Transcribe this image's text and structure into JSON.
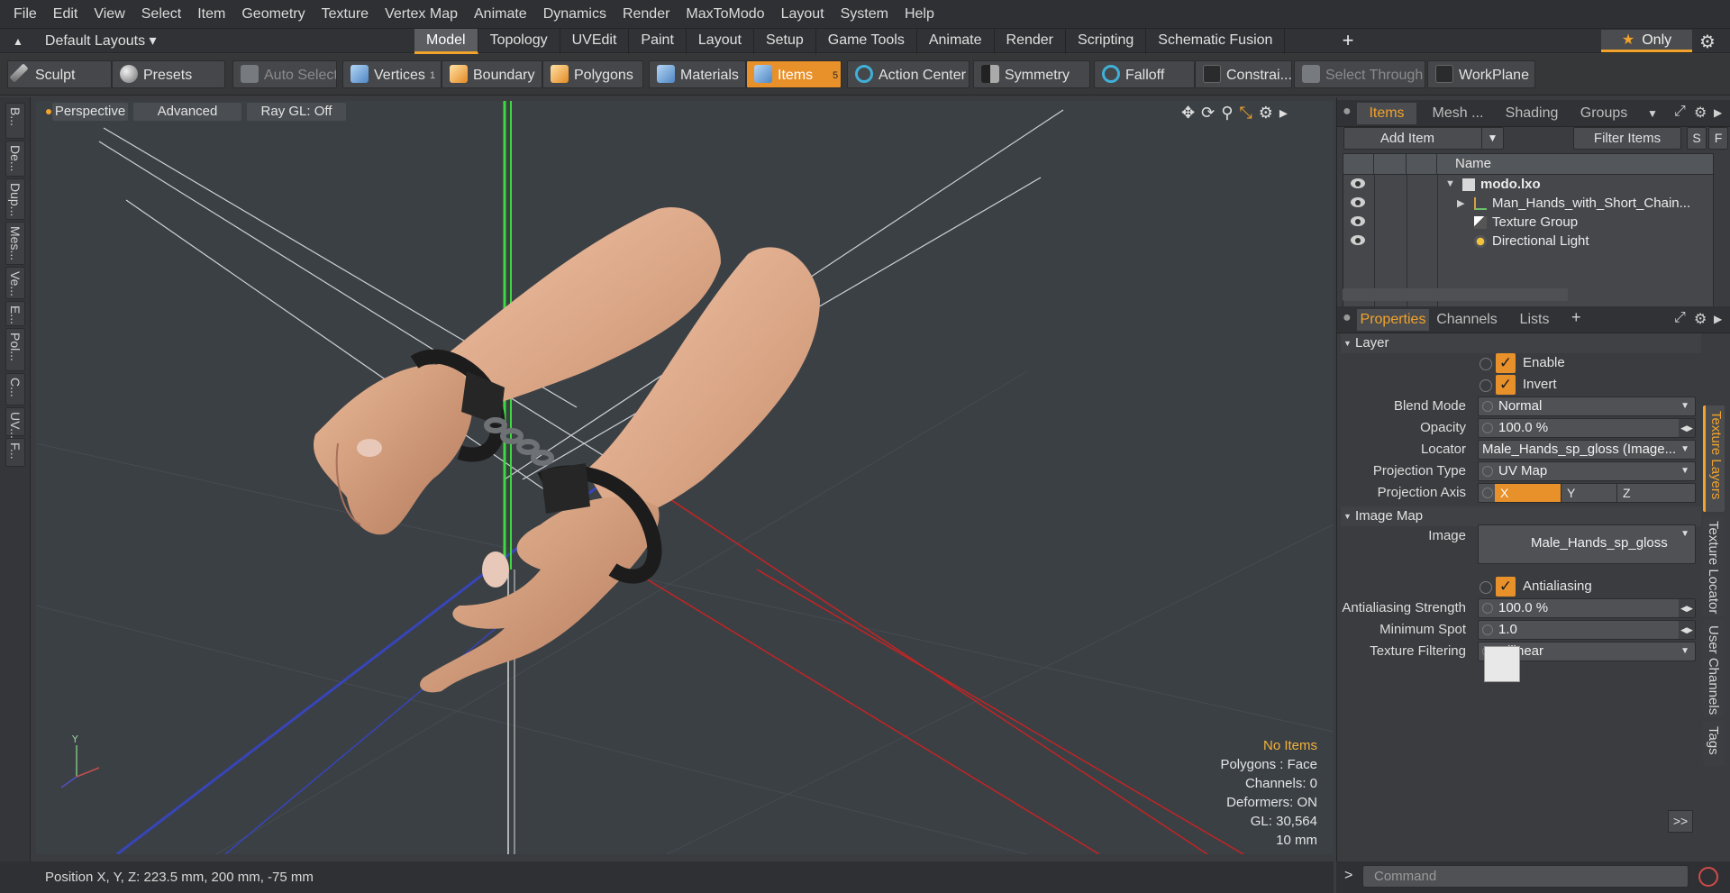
{
  "menu": [
    "File",
    "Edit",
    "View",
    "Select",
    "Item",
    "Geometry",
    "Texture",
    "Vertex Map",
    "Animate",
    "Dynamics",
    "Render",
    "MaxToModo",
    "Layout",
    "System",
    "Help"
  ],
  "layout_selector": "Default Layouts ▾",
  "layout_tabs": [
    "Model",
    "Topology",
    "UVEdit",
    "Paint",
    "Layout",
    "Setup",
    "Game Tools",
    "Animate",
    "Render",
    "Scripting",
    "Schematic Fusion"
  ],
  "only_label": "Only",
  "toolbar": {
    "sculpt": "Sculpt",
    "presets": "Presets",
    "auto_select": "Auto Select",
    "vertices": "Vertices",
    "vertices_count": "1",
    "boundary": "Boundary",
    "polygons": "Polygons",
    "materials": "Materials",
    "items": "Items",
    "items_count": "5",
    "action_center": "Action Center",
    "symmetry": "Symmetry",
    "falloff": "Falloff",
    "constraints": "Constrai...",
    "select_through": "Select Through",
    "workplane": "WorkPlane"
  },
  "left_strip": [
    "B...",
    "De...",
    "Dup...",
    "Mes...",
    "Ve...",
    "E...",
    "Pol...",
    "C...",
    "UV...",
    "F..."
  ],
  "viewport": {
    "view_mode": "Perspective",
    "advanced": "Advanced",
    "ray_gl": "Ray GL: Off",
    "info": {
      "selection": "No Items",
      "polygons": "Polygons : Face",
      "channels": "Channels: 0",
      "deformers": "Deformers: ON",
      "gl": "GL: 30,564",
      "scale": "10 mm"
    },
    "axis_y": "Y"
  },
  "status": "Position X, Y, Z:   223.5 mm, 200 mm, -75 mm",
  "items_panel": {
    "tabs": [
      "Items",
      "Mesh ...",
      "Shading",
      "Groups"
    ],
    "add_item": "Add Item",
    "filter_items": "Filter Items",
    "s_btn": "S",
    "f_btn": "F",
    "name_header": "Name",
    "rows": [
      {
        "label": "modo.lxo"
      },
      {
        "label": "Man_Hands_with_Short_Chain..."
      },
      {
        "label": "Texture Group"
      },
      {
        "label": "Directional Light"
      }
    ]
  },
  "properties": {
    "tabs": [
      "Properties",
      "Channels",
      "Lists"
    ],
    "layer_section": "Layer",
    "enable": "Enable",
    "invert": "Invert",
    "blend_mode_label": "Blend Mode",
    "blend_mode": "Normal",
    "opacity_label": "Opacity",
    "opacity": "100.0 %",
    "locator_label": "Locator",
    "locator": "Male_Hands_sp_gloss (Image...",
    "projection_type_label": "Projection Type",
    "projection_type": "UV Map",
    "projection_axis_label": "Projection Axis",
    "axes": [
      "X",
      "Y",
      "Z"
    ],
    "image_map_section": "Image Map",
    "image_label": "Image",
    "image": "Male_Hands_sp_gloss",
    "antialiasing": "Antialiasing",
    "aa_strength_label": "Antialiasing Strength",
    "aa_strength": "100.0 %",
    "min_spot_label": "Minimum Spot",
    "min_spot": "1.0",
    "tex_filter_label": "Texture Filtering",
    "tex_filter": "Bilinear",
    "more": ">>"
  },
  "side_tabs": [
    "Texture Layers",
    "Texture Locator",
    "User Channels",
    "Tags"
  ],
  "command_placeholder": "Command",
  "colors": {
    "accent": "#f2a32b",
    "viewport_bg": "#3b4045",
    "panel_bg": "#3a3c3f"
  }
}
